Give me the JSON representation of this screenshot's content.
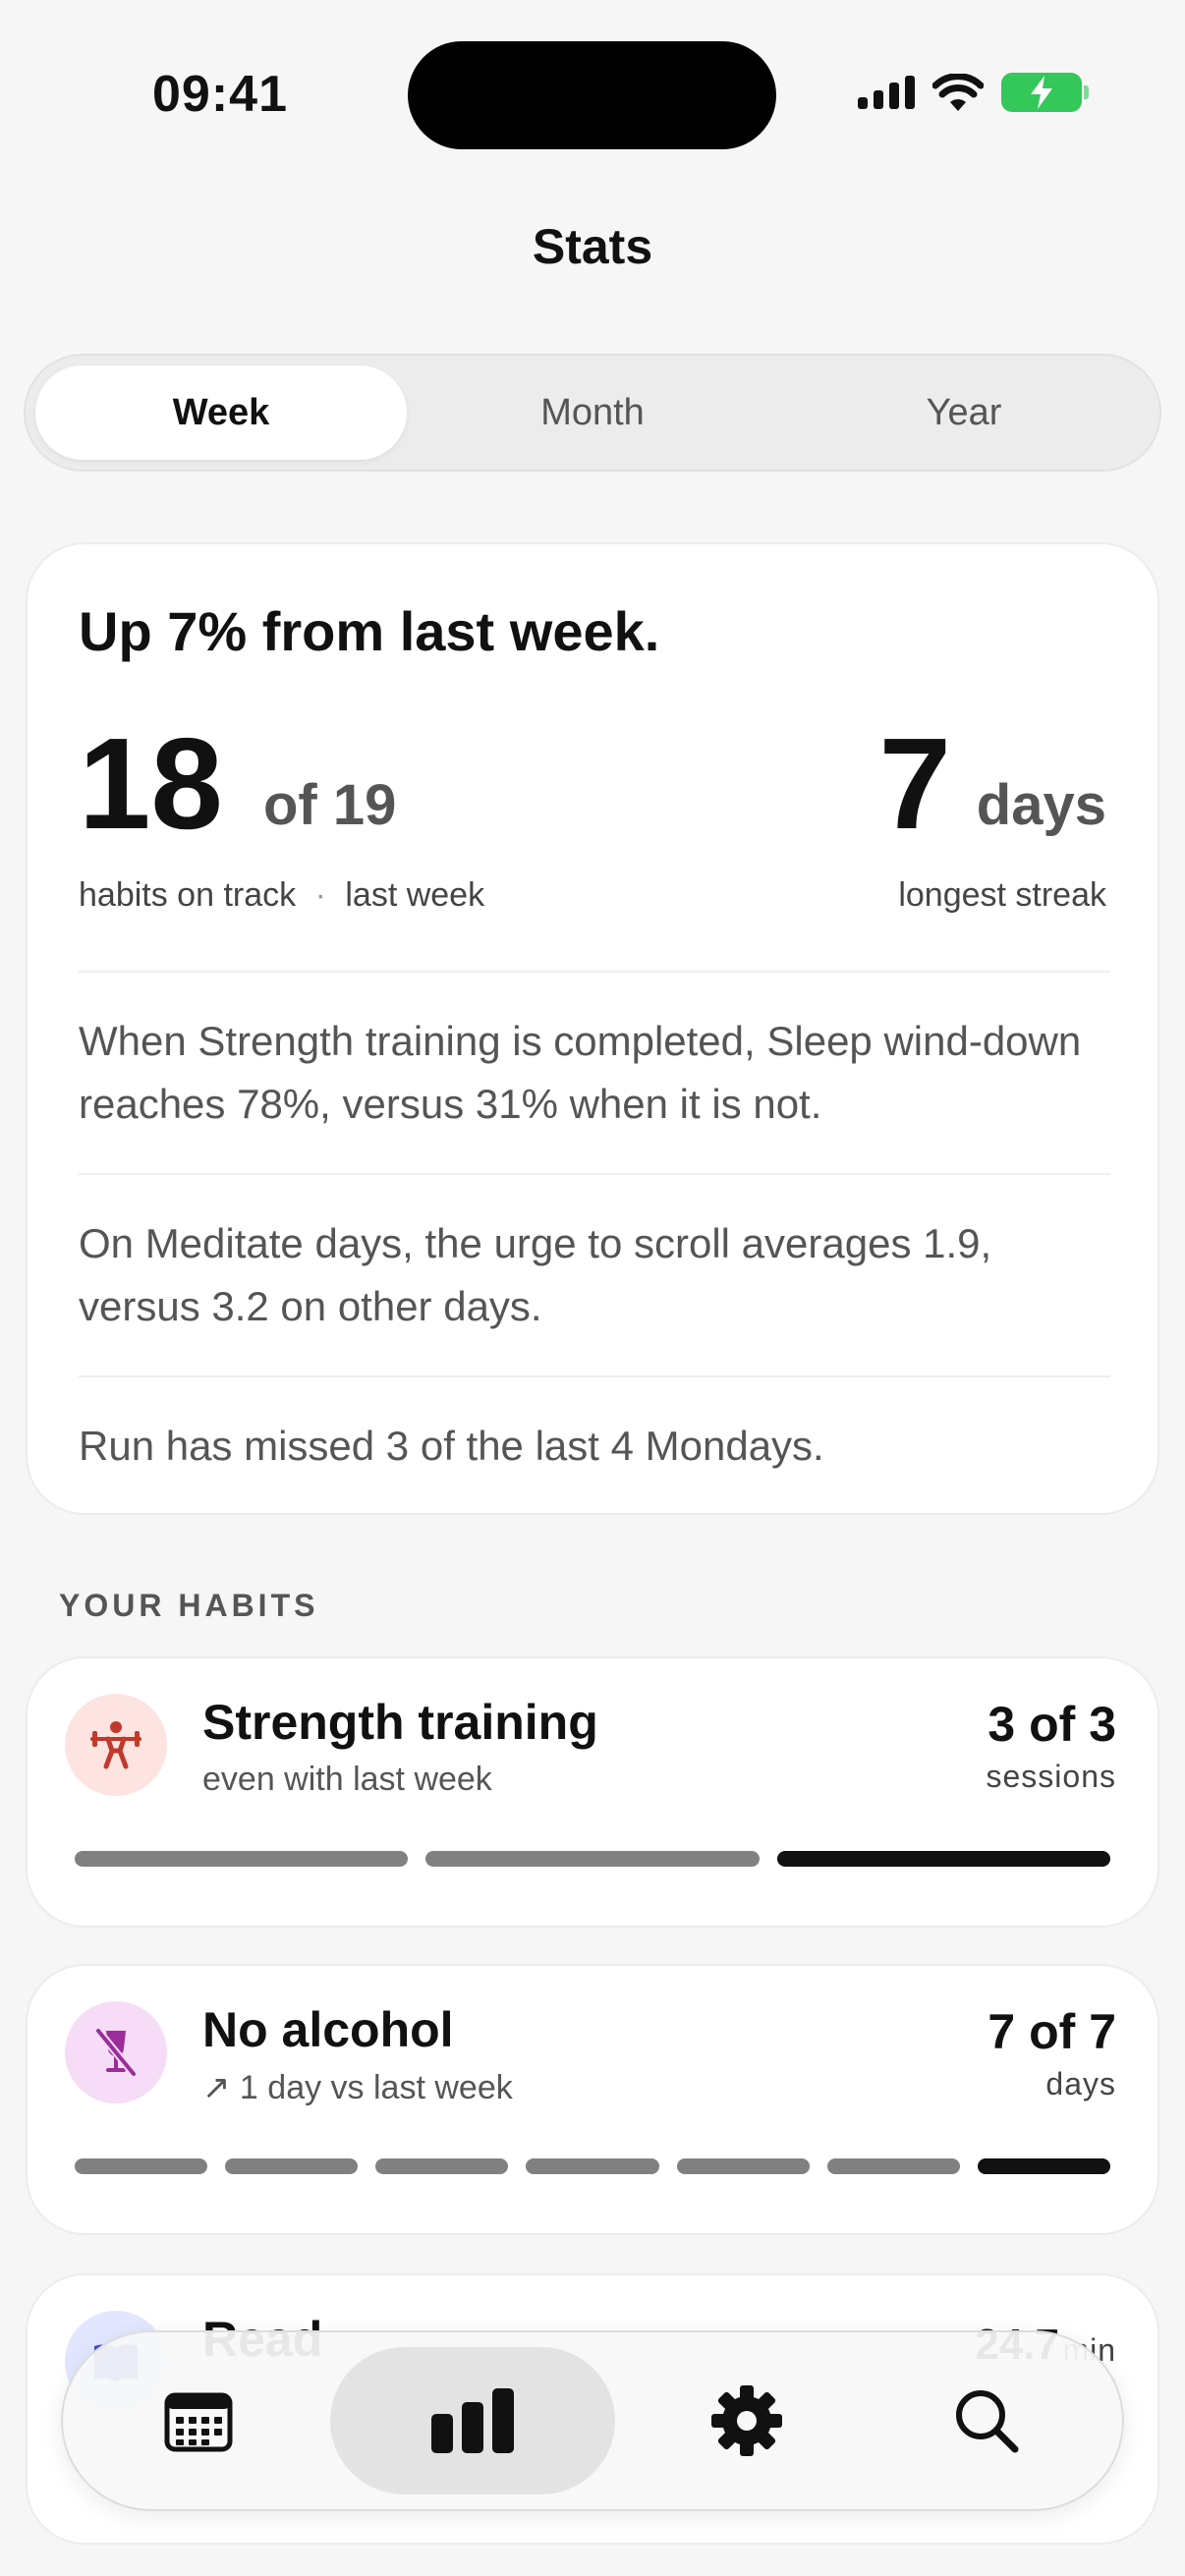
{
  "status": {
    "time": "09:41"
  },
  "page": {
    "title": "Stats"
  },
  "periods": [
    {
      "label": "Week",
      "selected": true
    },
    {
      "label": "Month",
      "selected": false
    },
    {
      "label": "Year",
      "selected": false
    }
  ],
  "summary": {
    "headline": "Up 7% from last week.",
    "on_track_value": "18",
    "on_track_total": "of 19",
    "on_track_caption": "habits on track",
    "compare_caption": "last week",
    "streak_value": "7",
    "streak_unit": "days",
    "streak_caption": "longest streak",
    "insights": [
      "When Strength training is completed, Sleep wind-down reaches 78%, versus 31% when it is not.",
      "On Meditate days, the urge to scroll averages 1.9, versus 3.2 on other days.",
      "Run has missed 3 of the last 4 Mondays."
    ]
  },
  "habits_section": {
    "label": "YOUR HABITS"
  },
  "habits": [
    {
      "name": "Strength training",
      "subtitle": "even with last week",
      "count": "3 of 3",
      "unit": "sessions",
      "segments": 3,
      "icon": "weightlifting-icon",
      "icon_color": "#c0392b",
      "icon_bg": "#fde4e1"
    },
    {
      "name": "No alcohol",
      "subtitle": "↗ 1 day vs last week",
      "count": "7 of 7",
      "unit": "days",
      "segments": 7,
      "icon": "no-wine-glass-icon",
      "icon_color": "#9b2d9b",
      "icon_bg": "#f6dcf6"
    },
    {
      "name": "Read",
      "count": "24.7",
      "unit": "min",
      "icon": "book-icon",
      "icon_color": "#3a4cc8",
      "icon_bg": "#e2e6ff"
    }
  ],
  "tabbar": {
    "tabs": [
      {
        "name": "calendar",
        "icon": "calendar-icon",
        "active": false
      },
      {
        "name": "stats",
        "icon": "bar-chart-icon",
        "active": true
      },
      {
        "name": "settings",
        "icon": "gear-icon",
        "active": false
      },
      {
        "name": "search",
        "icon": "search-icon",
        "active": false
      }
    ]
  },
  "colors": {
    "accent": "#111111",
    "battery": "#34c759",
    "bar_past": "#808080",
    "bar_current": "#111111"
  }
}
